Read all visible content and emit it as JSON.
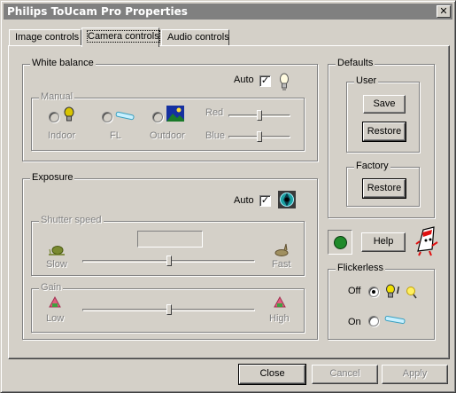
{
  "window": {
    "title": "Philips ToUcam Pro Properties",
    "close_glyph": "✕"
  },
  "tabs": [
    {
      "label": "Image controls"
    },
    {
      "label": "Camera controls"
    },
    {
      "label": "Audio controls"
    }
  ],
  "white_balance": {
    "legend": "White balance",
    "auto_label": "Auto",
    "auto_checked": true,
    "manual": {
      "legend": "Manual",
      "options": [
        {
          "label": "Indoor",
          "icon": "bulb-icon"
        },
        {
          "label": "FL",
          "icon": "fluorescent-tube-icon"
        },
        {
          "label": "Outdoor",
          "icon": "landscape-icon"
        }
      ],
      "red_label": "Red",
      "red_level": 0.5,
      "blue_label": "Blue",
      "blue_level": 0.5
    }
  },
  "exposure": {
    "legend": "Exposure",
    "auto_label": "Auto",
    "auto_checked": true,
    "shutter": {
      "legend": "Shutter speed",
      "value": "",
      "slow_label": "Slow",
      "fast_label": "Fast",
      "level": 0.5
    },
    "gain": {
      "legend": "Gain",
      "low_label": "Low",
      "high_label": "High",
      "level": 0.5
    }
  },
  "defaults": {
    "legend": "Defaults",
    "user": {
      "legend": "User",
      "save_label": "Save",
      "restore_label": "Restore"
    },
    "factory": {
      "legend": "Factory",
      "restore_label": "Restore"
    }
  },
  "help_label": "Help",
  "status_color": "#1f8a2a",
  "flickerless": {
    "legend": "Flickerless",
    "off_label": "Off",
    "on_label": "On",
    "selected": "Off",
    "slash": "/"
  },
  "footer": {
    "close_label": "Close",
    "cancel_label": "Cancel",
    "apply_label": "Apply"
  },
  "check_glyph": "✓"
}
